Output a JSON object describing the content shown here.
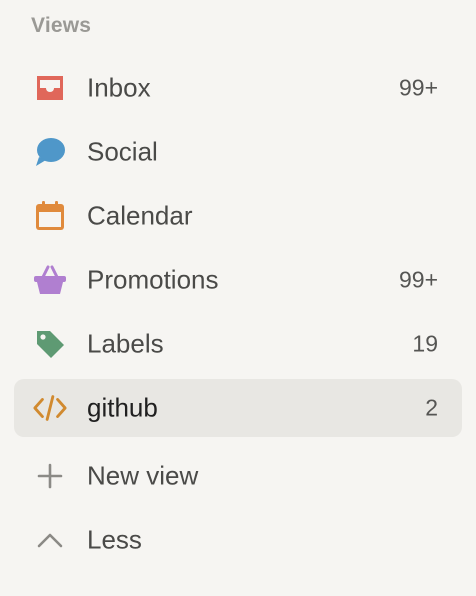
{
  "section_title": "Views",
  "items": [
    {
      "label": "Inbox",
      "count": "99+",
      "icon": "inbox-icon",
      "color": "#e0675a"
    },
    {
      "label": "Social",
      "count": "",
      "icon": "speech-bubble-icon",
      "color": "#4f97c9"
    },
    {
      "label": "Calendar",
      "count": "",
      "icon": "calendar-icon",
      "color": "#e08a3c"
    },
    {
      "label": "Promotions",
      "count": "99+",
      "icon": "basket-icon",
      "color": "#b07fd0"
    },
    {
      "label": "Labels",
      "count": "19",
      "icon": "tag-icon",
      "color": "#5e9a73"
    },
    {
      "label": "github",
      "count": "2",
      "icon": "code-icon",
      "color": "#d18a2f",
      "active": true
    },
    {
      "label": "New view",
      "count": "",
      "icon": "plus-icon",
      "color": "#8b8a86"
    },
    {
      "label": "Less",
      "count": "",
      "icon": "chevron-up-icon",
      "color": "#8b8a86"
    }
  ]
}
